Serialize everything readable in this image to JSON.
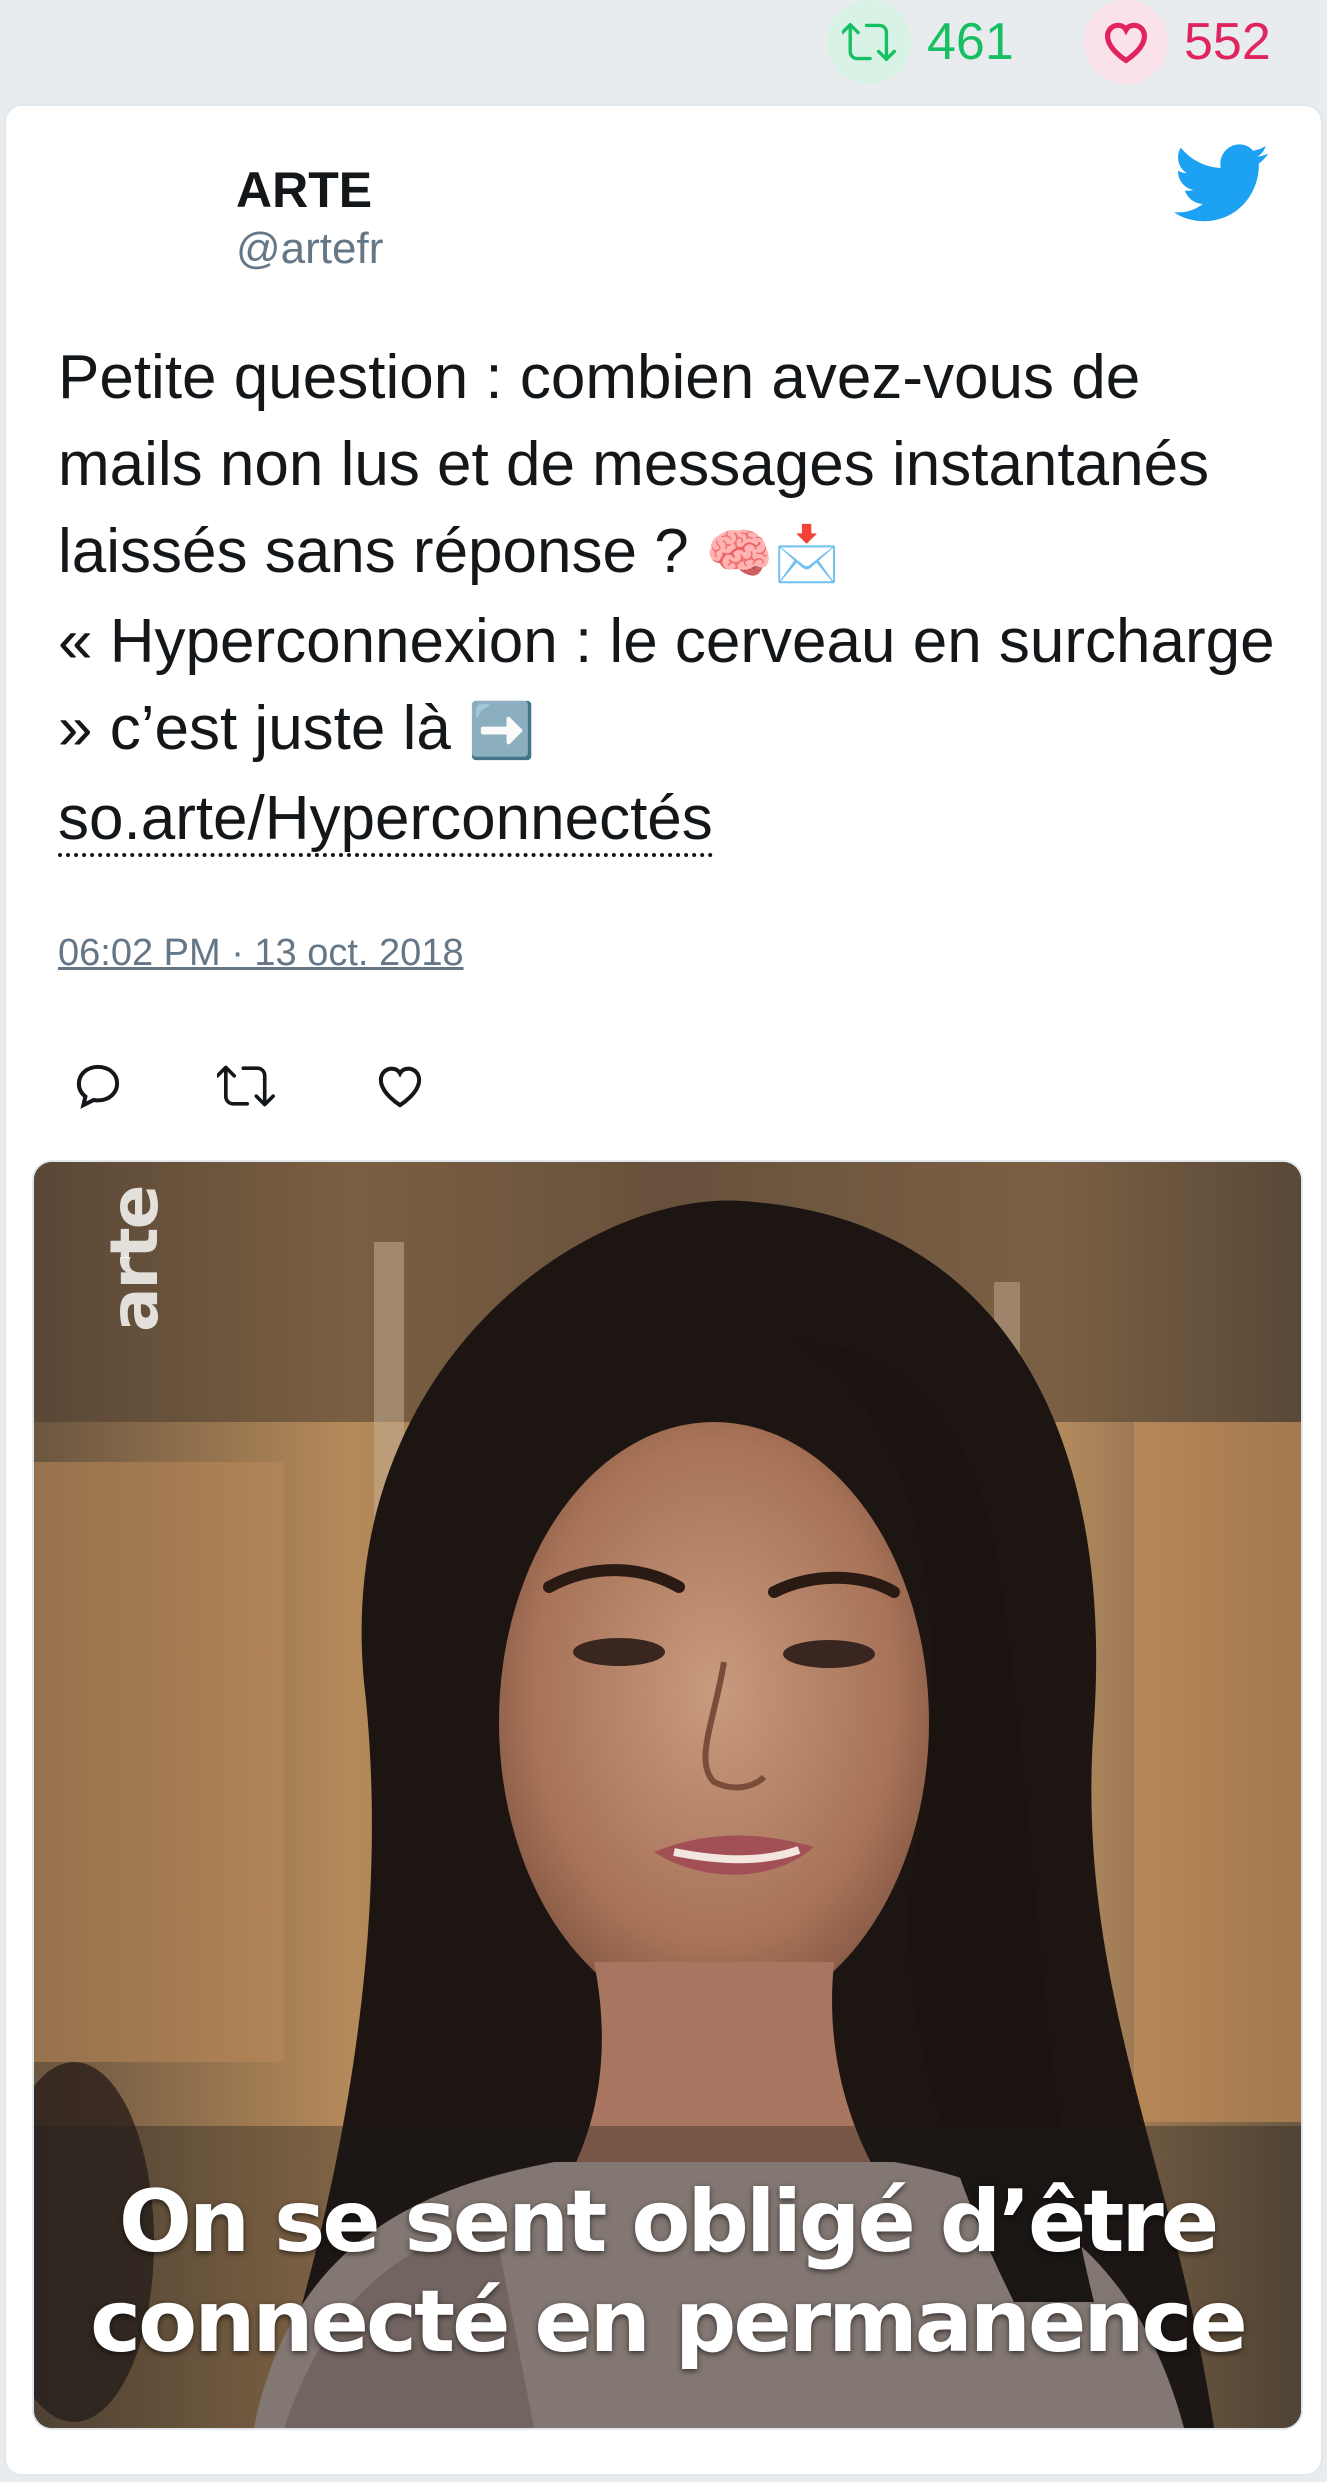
{
  "stats": {
    "retweets": "461",
    "likes": "552"
  },
  "author": {
    "name": "ARTE",
    "handle": "@artefr"
  },
  "tweet": {
    "line1": "Petite question : combien avez-vous de mails non lus et de messages instantanés laissés sans réponse ?",
    "emoji1": "🧠📩",
    "line2": "« Hyperconnexion : le cerveau en surcharge » c’est juste là",
    "emoji2": "➡️",
    "link": "so.arte/Hyperconnectés",
    "timestamp": "06:02 PM · 13 oct. 2018"
  },
  "media": {
    "watermark": "arte",
    "subtitle_line1": "On se sent obligé d’être",
    "subtitle_line2": "connecté en permanence"
  },
  "colors": {
    "retweet": "#17bf63",
    "like": "#e0245e",
    "twitter_blue": "#1da1f2",
    "secondary_text": "#657786"
  },
  "icons": [
    "retweet-icon",
    "heart-icon",
    "twitter-bird-icon",
    "reply-icon"
  ]
}
